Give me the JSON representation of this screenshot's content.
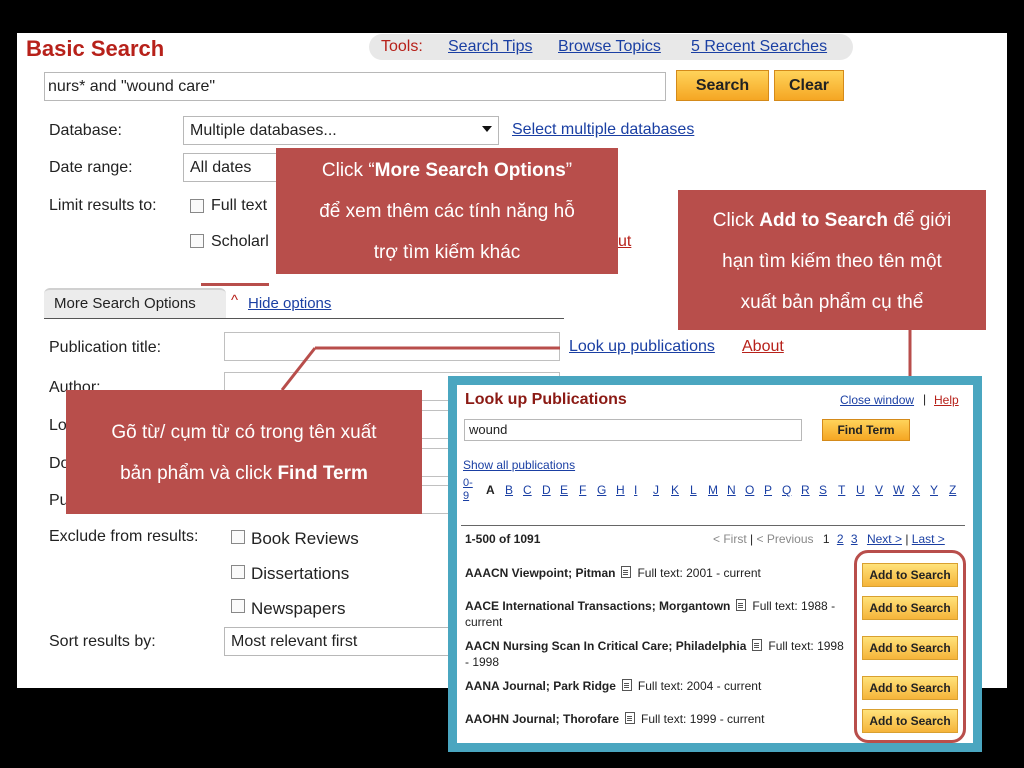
{
  "header": {
    "title": "Basic Search",
    "tools_label": "Tools:",
    "tools": [
      "Search Tips",
      "Browse Topics",
      "5 Recent Searches"
    ]
  },
  "search": {
    "query": "nurs* and \"wound care\"",
    "search_button": "Search",
    "clear_button": "Clear"
  },
  "form": {
    "database_label": "Database:",
    "database_value": "Multiple databases...",
    "select_databases_link": "Select multiple databases",
    "date_range_label": "Date range:",
    "date_range_value": "All dates",
    "limit_label": "Limit results to:",
    "full_text_label": "Full text",
    "scholarly_label": "Scholarl",
    "about_partial": "ut"
  },
  "options": {
    "tab_label": "More Search Options",
    "hide_options_link": "Hide options",
    "caret": "^",
    "publication_title_label": "Publication title:",
    "lookup_link": "Look up publications",
    "about_link": "About",
    "author_label": "Author:",
    "lo_label": "Lo",
    "do_label": "Do",
    "pu_label": "Pu",
    "exclude_label": "Exclude from results:",
    "exclude_items": [
      "Book Reviews",
      "Dissertations",
      "Newspapers"
    ],
    "sort_label": "Sort results by:",
    "sort_value": "Most relevant first"
  },
  "callouts": {
    "more_options": {
      "line1_pre": "Click “",
      "line1_bold": "More Search Options",
      "line1_post": "”",
      "line2": "để xem thêm các tính năng hỗ",
      "line3": "trợ tìm kiếm khác"
    },
    "add_to_search": {
      "line1_pre": "Click ",
      "line1_bold": "Add to Search",
      "line1_post": " để giới",
      "line2": "hạn tìm kiếm theo tên một",
      "line3": "xuất bản phẩm cụ thể"
    },
    "find_term": {
      "line1": "Gõ từ/ cụm từ có trong tên xuất",
      "line2_pre": "bản phẩm và click ",
      "line2_bold": "Find Term"
    }
  },
  "popup": {
    "title": "Look up Publications",
    "close_link": "Close window",
    "separator": "|",
    "help_link": "Help",
    "input_value": "wound",
    "find_button": "Find Term",
    "show_all_link": "Show all publications",
    "alphabet_first": "0-9",
    "alphabet": [
      "A",
      "B",
      "C",
      "D",
      "E",
      "F",
      "G",
      "H",
      "I",
      "J",
      "K",
      "L",
      "M",
      "N",
      "O",
      "P",
      "Q",
      "R",
      "S",
      "T",
      "U",
      "V",
      "W",
      "X",
      "Y",
      "Z"
    ],
    "active_letter": "A",
    "results_count": "1-500 of 1091",
    "pager": {
      "first": "< First",
      "previous": "< Previous",
      "pages": [
        "1",
        "2",
        "3"
      ],
      "next": "Next >",
      "last": "Last >"
    },
    "add_button": "Add to Search",
    "publications": [
      {
        "name": "AAACN Viewpoint; Pitman",
        "fulltext": "Full text: 2001 - current"
      },
      {
        "name": "AACE International Transactions; Morgantown",
        "fulltext": "Full text: 1988 - current"
      },
      {
        "name": "AACN Nursing Scan In Critical Care; Philadelphia",
        "fulltext": "Full text: 1998 - 1998"
      },
      {
        "name": "AANA Journal; Park Ridge",
        "fulltext": "Full text: 2004 - current"
      },
      {
        "name": "AAOHN Journal; Thorofare",
        "fulltext": "Full text: 1999 - current"
      }
    ]
  },
  "colors": {
    "brand_red": "#b7211a",
    "link_blue": "#1a3fa3",
    "callout_bg": "#b84e4b",
    "popup_border": "#4aa6c0",
    "button_orange": "#f5a623"
  }
}
